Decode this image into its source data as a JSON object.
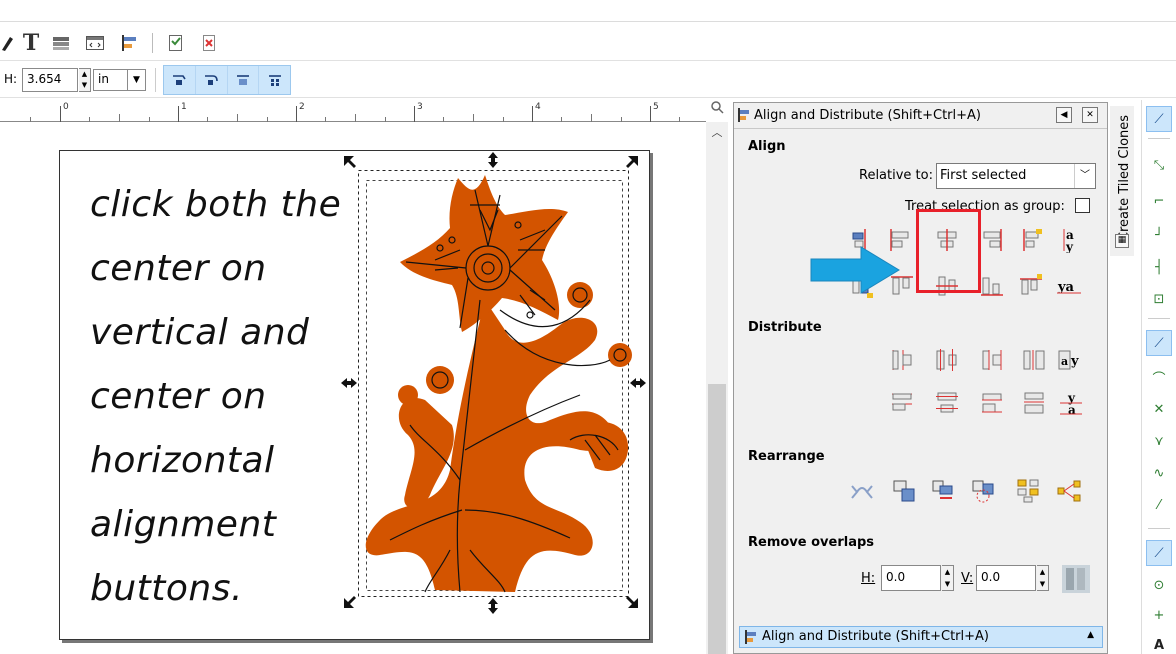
{
  "toolbar": {
    "text_tool_glyph": "T"
  },
  "controls": {
    "h_label": "H:",
    "h_value": "3.654",
    "unit_value": "in"
  },
  "ruler": {
    "ticks": [
      "0",
      "1",
      "2",
      "3",
      "4",
      "5"
    ]
  },
  "canvas": {
    "instruction_lines": [
      "click both the",
      "center on",
      "vertical and",
      "center on",
      "horizontal",
      "alignment",
      "buttons."
    ],
    "artwork": {
      "fill_color": "#d35400",
      "line_color": "#111111"
    }
  },
  "dock": {
    "title": "Align and Distribute (Shift+Ctrl+A)",
    "align_section": "Align",
    "relative_to_label": "Relative to:",
    "relative_to_value": "First selected",
    "treat_group_label": "Treat selection as group:",
    "distribute_section": "Distribute",
    "rearrange_section": "Rearrange",
    "remove_overlaps_section": "Remove overlaps",
    "h_label": "H:",
    "h_value": "0.0",
    "v_label": "V:",
    "v_value": "0.0",
    "tab_label": "Align and Distribute (Shift+Ctrl+A)",
    "highlight_color": "#e8202a",
    "arrow_color": "#1aa3e0"
  },
  "side_tab": {
    "label": "Create Tiled Clones"
  }
}
